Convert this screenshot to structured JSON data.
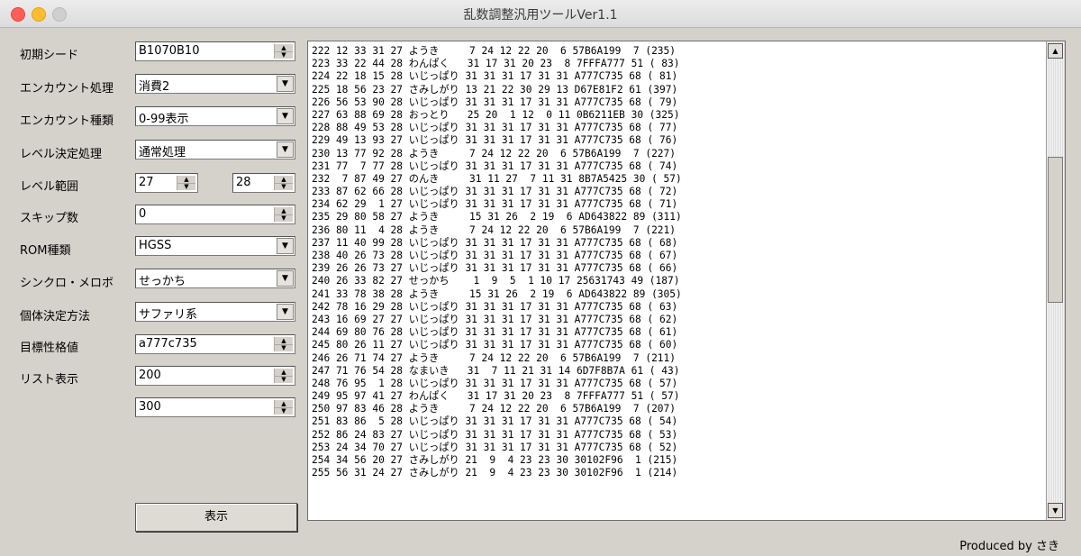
{
  "window": {
    "title": "乱数調整汎用ツールVer1.1"
  },
  "form": {
    "seed_label": "初期シード",
    "seed_value": "B1070B10",
    "encounter_proc_label": "エンカウント処理",
    "encounter_proc_value": "消費2",
    "encounter_type_label": "エンカウント種類",
    "encounter_type_value": "0-99表示",
    "level_proc_label": "レベル決定処理",
    "level_proc_value": "通常処理",
    "level_range_label": "レベル範囲",
    "level_min": "27",
    "level_max": "28",
    "skip_label": "スキップ数",
    "skip_value": "0",
    "rom_label": "ROM種類",
    "rom_value": "HGSS",
    "synchro_label": "シンクロ・メロボ",
    "synchro_value": "せっかち",
    "pid_method_label": "個体決定方法",
    "pid_method_value": "サファリ系",
    "target_label": "目標性格値",
    "target_value": "a777c735",
    "list_label": "リスト表示",
    "list_start": "200",
    "list_count": "300",
    "show_button": "表示"
  },
  "results": [
    "222 12 33 31 27 ようき     7 24 12 22 20  6 57B6A199  7 (235)",
    "223 33 22 44 28 わんぱく   31 17 31 20 23  8 7FFFA777 51 ( 83)",
    "224 22 18 15 28 いじっぱり 31 31 31 17 31 31 A777C735 68 ( 81)",
    "225 18 56 23 27 さみしがり 13 21 22 30 29 13 D67E81F2 61 (397)",
    "226 56 53 90 28 いじっぱり 31 31 31 17 31 31 A777C735 68 ( 79)",
    "227 63 88 69 28 おっとり   25 20  1 12  0 11 0B6211EB 30 (325)",
    "228 88 49 53 28 いじっぱり 31 31 31 17 31 31 A777C735 68 ( 77)",
    "229 49 13 93 27 いじっぱり 31 31 31 17 31 31 A777C735 68 ( 76)",
    "230 13 77 92 28 ようき     7 24 12 22 20  6 57B6A199  7 (227)",
    "231 77  7 77 28 いじっぱり 31 31 31 17 31 31 A777C735 68 ( 74)",
    "232  7 87 49 27 のんき     31 11 27  7 11 31 8B7A5425 30 ( 57)",
    "233 87 62 66 28 いじっぱり 31 31 31 17 31 31 A777C735 68 ( 72)",
    "234 62 29  1 27 いじっぱり 31 31 31 17 31 31 A777C735 68 ( 71)",
    "235 29 80 58 27 ようき     15 31 26  2 19  6 AD643822 89 (311)",
    "236 80 11  4 28 ようき     7 24 12 22 20  6 57B6A199  7 (221)",
    "237 11 40 99 28 いじっぱり 31 31 31 17 31 31 A777C735 68 ( 68)",
    "238 40 26 73 28 いじっぱり 31 31 31 17 31 31 A777C735 68 ( 67)",
    "239 26 26 73 27 いじっぱり 31 31 31 17 31 31 A777C735 68 ( 66)",
    "240 26 33 82 27 せっかち    1  9  5  1 10 17 25631743 49 (187)",
    "241 33 78 38 28 ようき     15 31 26  2 19  6 AD643822 89 (305)",
    "242 78 16 29 28 いじっぱり 31 31 31 17 31 31 A777C735 68 ( 63)",
    "243 16 69 27 27 いじっぱり 31 31 31 17 31 31 A777C735 68 ( 62)",
    "244 69 80 76 28 いじっぱり 31 31 31 17 31 31 A777C735 68 ( 61)",
    "245 80 26 11 27 いじっぱり 31 31 31 17 31 31 A777C735 68 ( 60)",
    "246 26 71 74 27 ようき     7 24 12 22 20  6 57B6A199  7 (211)",
    "247 71 76 54 28 なまいき   31  7 11 21 31 14 6D7F8B7A 61 ( 43)",
    "248 76 95  1 28 いじっぱり 31 31 31 17 31 31 A777C735 68 ( 57)",
    "249 95 97 41 27 わんぱく   31 17 31 20 23  8 7FFFA777 51 ( 57)",
    "250 97 83 46 28 ようき     7 24 12 22 20  6 57B6A199  7 (207)",
    "251 83 86  5 28 いじっぱり 31 31 31 17 31 31 A777C735 68 ( 54)",
    "252 86 24 83 27 いじっぱり 31 31 31 17 31 31 A777C735 68 ( 53)",
    "253 24 34 70 27 いじっぱり 31 31 31 17 31 31 A777C735 68 ( 52)",
    "254 34 56 20 27 さみしがり 21  9  4 23 23 30 30102F96  1 (215)",
    "255 56 31 24 27 さみしがり 21  9  4 23 23 30 30102F96  1 (214)"
  ],
  "icons": {
    "spin_up": "▲",
    "spin_down": "▼",
    "dropdown": "▼",
    "scroll_up": "▲",
    "scroll_down": "▼"
  },
  "footer": {
    "credit": "Produced by さき"
  }
}
